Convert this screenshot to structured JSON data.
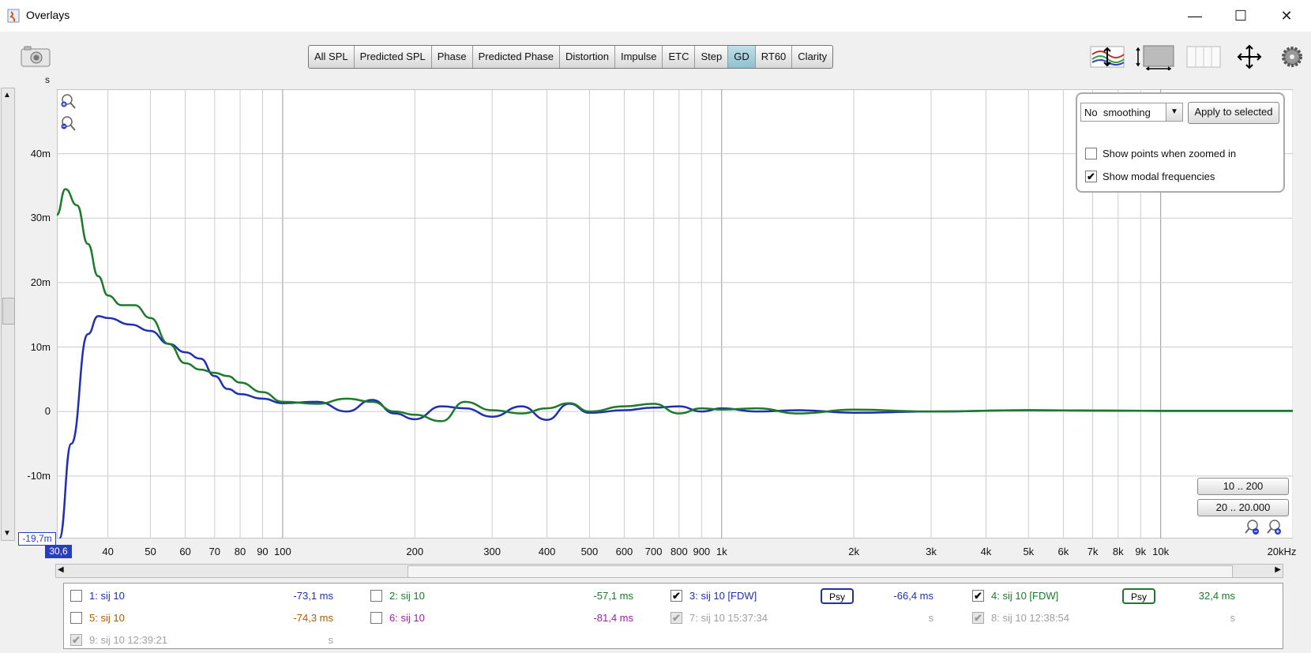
{
  "window": {
    "title": "Overlays",
    "min": "—",
    "max": "☐",
    "close": "✕"
  },
  "tabs": [
    "All SPL",
    "Predicted SPL",
    "Phase",
    "Predicted Phase",
    "Distortion",
    "Impulse",
    "ETC",
    "Step",
    "GD",
    "RT60",
    "Clarity"
  ],
  "active_tab": "GD",
  "icons": {
    "camera": "camera-icon",
    "curve_scale": "curve-scale-icon",
    "graph_size": "graph-size-icon",
    "columns": "columns-icon",
    "move": "pan-arrows-icon",
    "settings": "gear-icon"
  },
  "axis": {
    "y_unit": "s",
    "y_ticks": [
      "40m",
      "30m",
      "20m",
      "10m",
      "0",
      "-10m"
    ],
    "x_ticks": [
      "40",
      "50",
      "60",
      "70",
      "80",
      "90",
      "100",
      "200",
      "300",
      "400",
      "500",
      "600",
      "700",
      "800",
      "900",
      "1k",
      "2k",
      "3k",
      "4k",
      "5k",
      "6k",
      "7k",
      "8k",
      "9k",
      "10k",
      "20kHz"
    ],
    "y_min_box": "-19,7m",
    "x_min_box": "30,6"
  },
  "panel": {
    "smoothing": "No  smoothing",
    "apply_button": "Apply to selected",
    "show_points": "Show points when zoomed in",
    "show_points_checked": false,
    "show_modal": "Show modal frequencies",
    "show_modal_checked": true
  },
  "range_buttons": [
    "10 .. 200",
    "20 .. 20.000"
  ],
  "legend": [
    {
      "label": "1: sij 10",
      "value": "-73,1 ms",
      "checked": false,
      "enabled": true,
      "color": "#1f2fb0",
      "psy": false
    },
    {
      "label": "2: sij 10",
      "value": "-57,1 ms",
      "checked": false,
      "enabled": true,
      "color": "#1c7a2a",
      "psy": false
    },
    {
      "label": "3: sij 10 [FDW]",
      "value": "-66,4 ms",
      "checked": true,
      "enabled": true,
      "color": "#1f2fb0",
      "psy": true
    },
    {
      "label": "4: sij 10 [FDW]",
      "value": "32,4 ms",
      "checked": true,
      "enabled": true,
      "color": "#1c7a2a",
      "psy": true
    },
    {
      "label": "5: sij 10",
      "value": "-74,3 ms",
      "checked": false,
      "enabled": true,
      "color": "#b05a00",
      "psy": false
    },
    {
      "label": "6: sij 10",
      "value": "-81,4 ms",
      "checked": false,
      "enabled": true,
      "color": "#9b1fa8",
      "psy": false
    },
    {
      "label": "7: sij 10 15:37:34",
      "value": "s",
      "checked": true,
      "enabled": false,
      "color": "#a0a0a0",
      "psy": false
    },
    {
      "label": "8: sij 10 12:38:54",
      "value": "s",
      "checked": true,
      "enabled": false,
      "color": "#a0a0a0",
      "psy": false
    },
    {
      "label": "9: sij 10 12:39:21",
      "value": "s",
      "checked": true,
      "enabled": false,
      "color": "#a0a0a0",
      "psy": false
    }
  ],
  "psy_label": "Psy",
  "chart_data": {
    "type": "line",
    "xlabel": "",
    "ylabel": "",
    "x_scale": "log",
    "x_unit": "Hz",
    "xlim": [
      30.6,
      20000
    ],
    "ylim": [
      -0.0197,
      0.05
    ],
    "grid": true,
    "series": [
      {
        "name": "3: sij 10 [FDW]",
        "color": "#1f2fb0",
        "x": [
          31,
          33,
          36,
          38,
          40,
          45,
          50,
          55,
          60,
          65,
          70,
          75,
          80,
          90,
          100,
          120,
          140,
          160,
          180,
          200,
          230,
          260,
          300,
          350,
          400,
          450,
          500,
          600,
          700,
          800,
          900,
          1000,
          1200,
          1500,
          2000,
          3000,
          5000,
          10000,
          20000
        ],
        "y": [
          -0.0197,
          -0.005,
          0.012,
          0.0148,
          0.0145,
          0.0135,
          0.0125,
          0.0105,
          0.0092,
          0.0082,
          0.0055,
          0.0035,
          0.0027,
          0.002,
          0.0013,
          0.0015,
          0.0,
          0.0018,
          -0.0003,
          -0.0012,
          0.0008,
          0.0005,
          -0.0008,
          0.0008,
          -0.0013,
          0.0012,
          -0.0002,
          0.0002,
          0.0006,
          0.0008,
          0.0,
          0.0005,
          0.0,
          0.0002,
          -0.0002,
          0.0,
          0.0002,
          0.0001,
          0.0001
        ]
      },
      {
        "name": "4: sij 10 [FDW]",
        "color": "#1c7a2a",
        "x": [
          30.6,
          32,
          34,
          36,
          38,
          40,
          43,
          46,
          50,
          55,
          60,
          65,
          70,
          75,
          80,
          90,
          100,
          120,
          140,
          160,
          180,
          200,
          230,
          260,
          300,
          350,
          400,
          450,
          500,
          600,
          700,
          800,
          900,
          1000,
          1200,
          1500,
          2000,
          3000,
          5000,
          10000,
          20000
        ],
        "y": [
          0.0305,
          0.0345,
          0.032,
          0.026,
          0.021,
          0.018,
          0.0165,
          0.0165,
          0.0145,
          0.0105,
          0.0075,
          0.0065,
          0.006,
          0.0055,
          0.0045,
          0.003,
          0.0015,
          0.0012,
          0.002,
          0.0015,
          0.0,
          -0.0005,
          -0.0015,
          0.0015,
          0.0002,
          -0.0003,
          0.0005,
          0.0013,
          0.0,
          0.0008,
          0.0012,
          -0.0003,
          0.0005,
          0.0003,
          0.0005,
          -0.0003,
          0.0003,
          0.0,
          0.0002,
          0.0001,
          0.0001
        ]
      }
    ]
  }
}
